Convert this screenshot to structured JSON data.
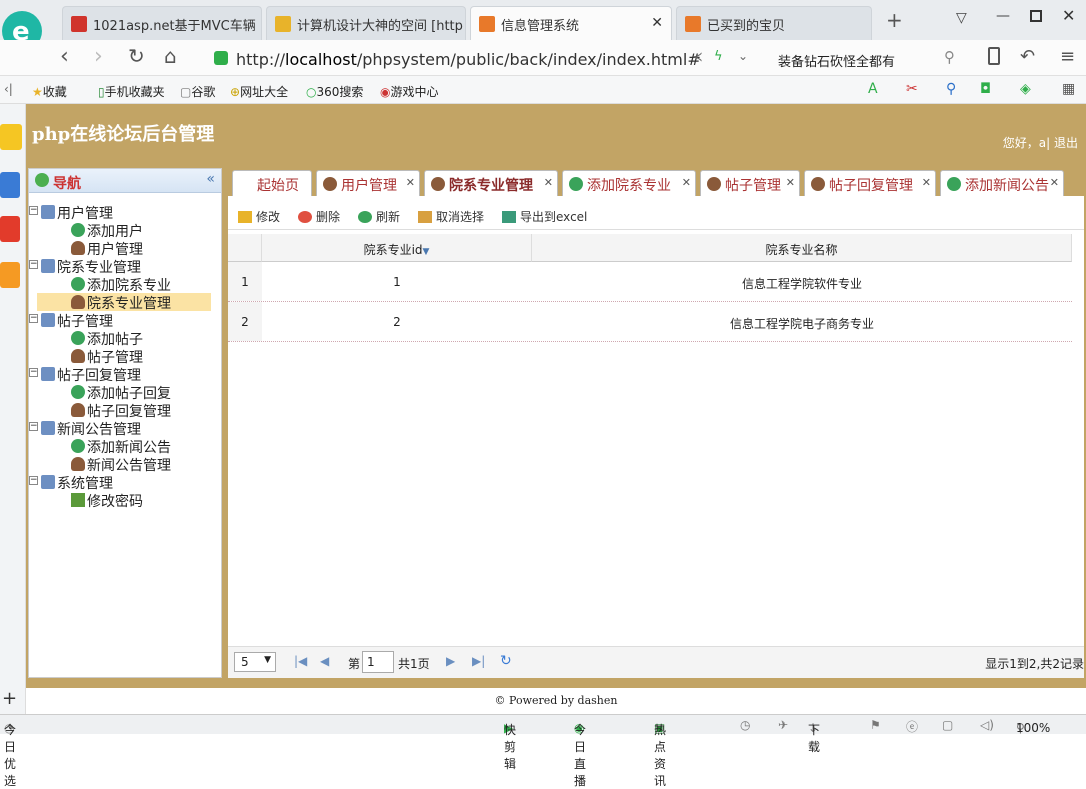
{
  "browser": {
    "tabs": [
      {
        "label": "1021asp.net基于MVC车辆",
        "color": "#d0342c"
      },
      {
        "label": "计算机设计大神的空间 [http",
        "color": "#e8b32a"
      },
      {
        "label": "信息管理系统",
        "color": "#e8792a",
        "active": true
      },
      {
        "label": "已买到的宝贝",
        "color": "#e8792a"
      }
    ],
    "new_tab": "+",
    "url_prefix": "http://",
    "url_host": "localhost",
    "url_path": "/phpsystem/public/back/index/index.html#",
    "search_text": "装备钻石砍怪全都有",
    "bookmarks": [
      "收藏",
      "手机收藏夹",
      "谷歌",
      "网址大全",
      "360搜索",
      "游戏中心"
    ]
  },
  "app": {
    "title": "php在线论坛后台管理",
    "greeting": "您好，a| 退出"
  },
  "nav": {
    "title": "导航",
    "tree": [
      {
        "label": "用户管理",
        "level": 0
      },
      {
        "label": "添加用户",
        "level": 1,
        "icon": "add"
      },
      {
        "label": "用户管理",
        "level": 1,
        "icon": "user"
      },
      {
        "label": "院系专业管理",
        "level": 0
      },
      {
        "label": "添加院系专业",
        "level": 1,
        "icon": "add"
      },
      {
        "label": "院系专业管理",
        "level": 1,
        "icon": "user",
        "selected": true
      },
      {
        "label": "帖子管理",
        "level": 0
      },
      {
        "label": "添加帖子",
        "level": 1,
        "icon": "add"
      },
      {
        "label": "帖子管理",
        "level": 1,
        "icon": "user"
      },
      {
        "label": "帖子回复管理",
        "level": 0
      },
      {
        "label": "添加帖子回复",
        "level": 1,
        "icon": "add"
      },
      {
        "label": "帖子回复管理",
        "level": 1,
        "icon": "user"
      },
      {
        "label": "新闻公告管理",
        "level": 0
      },
      {
        "label": "添加新闻公告",
        "level": 1,
        "icon": "add"
      },
      {
        "label": "新闻公告管理",
        "level": 1,
        "icon": "user"
      },
      {
        "label": "系统管理",
        "level": 0
      },
      {
        "label": "修改密码",
        "level": 1,
        "icon": "pencil"
      }
    ]
  },
  "content_tabs": [
    {
      "label": "起始页",
      "icon": "none"
    },
    {
      "label": "用户管理",
      "icon": "user"
    },
    {
      "label": "院系专业管理",
      "icon": "user",
      "active": true
    },
    {
      "label": "添加院系专业",
      "icon": "add"
    },
    {
      "label": "帖子管理",
      "icon": "user"
    },
    {
      "label": "帖子回复管理",
      "icon": "user"
    },
    {
      "label": "添加新闻公告",
      "icon": "add"
    }
  ],
  "toolbar": {
    "edit": "修改",
    "delete": "删除",
    "refresh": "刷新",
    "unselect": "取消选择",
    "export": "导出到excel"
  },
  "grid": {
    "columns": [
      "院系专业id",
      "院系专业名称"
    ],
    "rows": [
      {
        "num": "1",
        "id": "1",
        "name": "信息工程学院软件专业"
      },
      {
        "num": "2",
        "id": "2",
        "name": "信息工程学院电子商务专业"
      }
    ]
  },
  "pager": {
    "page_size": "5",
    "page_label": "第",
    "page_value": "1",
    "total_pages": "共1页",
    "summary": "显示1到2,共2记录"
  },
  "footer": "© Powered by dashen",
  "status": {
    "left": "今日优选",
    "items": [
      "快剪辑",
      "今日直播",
      "热点资讯",
      "下载"
    ],
    "zoom": "100%"
  },
  "colors": {
    "accent": "#c2a465",
    "selected": "#fbe3a4"
  }
}
